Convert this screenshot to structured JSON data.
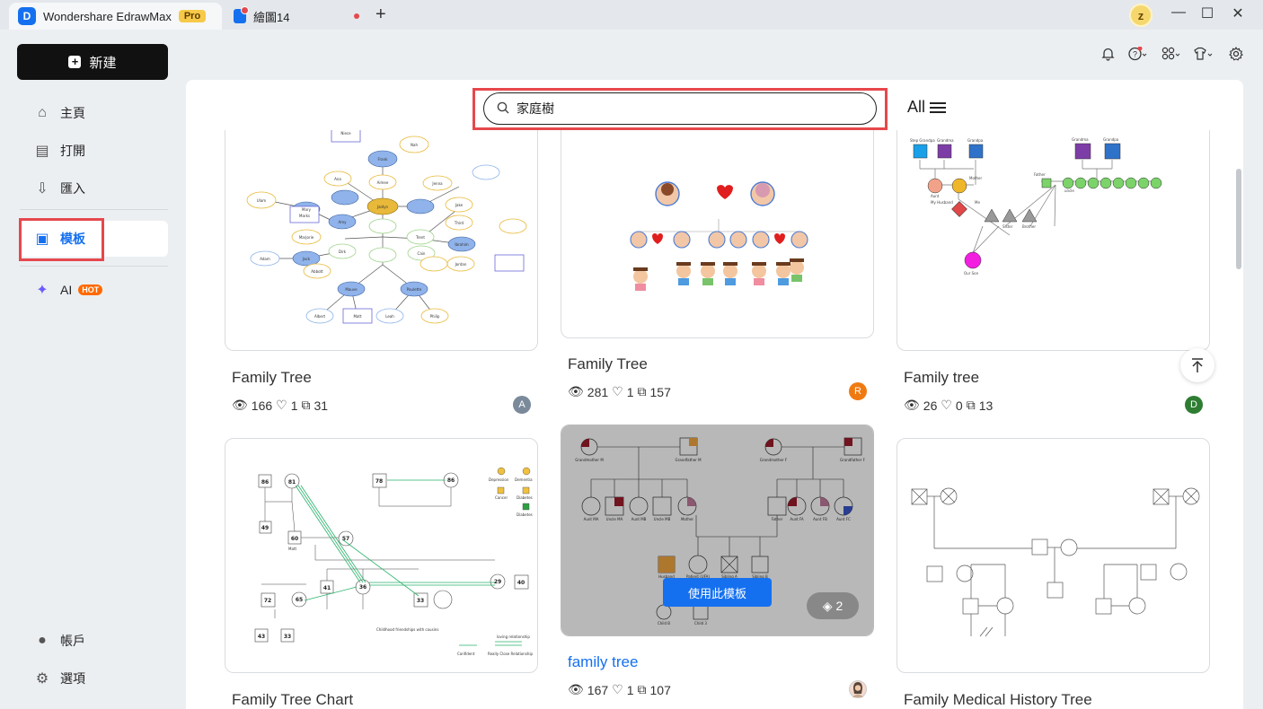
{
  "titlebar": {
    "app_title": "Wondershare EdrawMax",
    "pro_badge": "Pro",
    "document_tab": "繪圖14",
    "new_tab": "+",
    "user_initial": "z",
    "window_controls": [
      "—",
      "☐",
      "✕"
    ]
  },
  "sidebar": {
    "new_button": "新建",
    "items": [
      {
        "label": "主頁",
        "icon": "home-icon"
      },
      {
        "label": "打開",
        "icon": "open-file-icon"
      },
      {
        "label": "匯入",
        "icon": "import-icon"
      },
      {
        "label": "模板",
        "icon": "template-icon"
      },
      {
        "label": "AI",
        "icon": "ai-sparkle-icon",
        "badge": "HOT"
      }
    ],
    "bottom": [
      {
        "label": "帳戶",
        "icon": "account-icon"
      },
      {
        "label": "選項",
        "icon": "settings-icon"
      }
    ]
  },
  "header_icons": [
    "bell-icon",
    "help-icon",
    "apps-icon",
    "shirt-icon",
    "gear-icon"
  ],
  "search": {
    "value": "家庭樹",
    "filter_label": "All"
  },
  "cards": [
    {
      "title": "Family Tree",
      "views": "166",
      "likes": "1",
      "copies": "31",
      "author": "A",
      "author_color": "#7a8a9a"
    },
    {
      "title": "Family Tree",
      "views": "281",
      "likes": "1",
      "copies": "157",
      "author": "R",
      "author_color": "#f07a12"
    },
    {
      "title": "Family tree",
      "views": "26",
      "likes": "0",
      "copies": "13",
      "author": "D",
      "author_color": "#2e7d32"
    },
    {
      "title": "Family Tree Chart"
    },
    {
      "title": "family tree",
      "views": "167",
      "likes": "1",
      "copies": "107",
      "use_button": "使用此模板",
      "page_count": "2"
    },
    {
      "title": "Family Medical History Tree"
    }
  ],
  "diagram_text": {
    "c1_top": [
      "Niece",
      "Nah",
      "Frank",
      "Ulam",
      "Mary",
      "Ana",
      "Jenna",
      "Jake",
      "Amy",
      "Aimee",
      "Jaidyn",
      "Third",
      "Dirk",
      "Abbott",
      "Jack",
      "Trent",
      "Marks",
      "Adam",
      "Ibrahim",
      "Jordan",
      "Marjorie",
      "Albert",
      "Mauve",
      "Paulette",
      "Leah",
      "Matt",
      "Cain",
      "Philip"
    ],
    "c3_labels": [
      "Step Grandpa",
      "Grandma",
      "Grandpa",
      "Grandma",
      "Grandpa",
      "Aunt",
      "Mother",
      "Father",
      "uncle",
      "My Husband",
      "Me",
      "Sister",
      "Brother",
      "Our Son"
    ],
    "c4_labels": [
      "Depression",
      "Dementia",
      "Cancer",
      "Diabetes",
      "Diabetes",
      "Matt",
      "Confident",
      "Really Close Relationship",
      "loving relationship",
      "Childhood friendships with cousins"
    ],
    "c5_labels": [
      "Grandmother M",
      "Grandfather M",
      "Grandmother F",
      "Grandfather F",
      "Aunt MA",
      "Uncle MA",
      "Aunt MB",
      "Uncle MB",
      "Mother",
      "Father",
      "Aunt FA",
      "Aunt FB",
      "Aunt FC",
      "Husband",
      "Patient (UFA)",
      "Sibling A",
      "Sibling B",
      "Child B",
      "Child 3"
    ]
  }
}
